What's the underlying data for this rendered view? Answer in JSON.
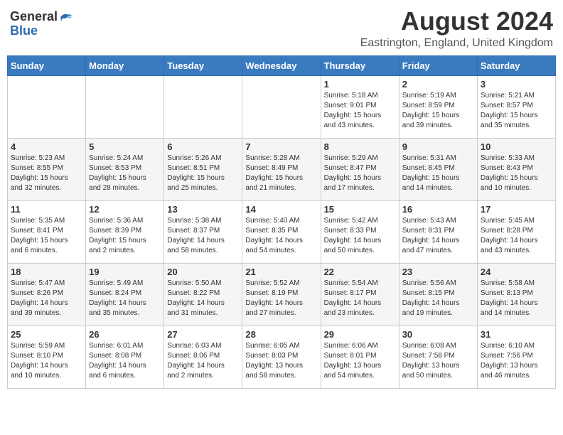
{
  "header": {
    "logo_general": "General",
    "logo_blue": "Blue",
    "month_year": "August 2024",
    "location": "Eastrington, England, United Kingdom"
  },
  "days_of_week": [
    "Sunday",
    "Monday",
    "Tuesday",
    "Wednesday",
    "Thursday",
    "Friday",
    "Saturday"
  ],
  "weeks": [
    [
      {
        "day": "",
        "info": ""
      },
      {
        "day": "",
        "info": ""
      },
      {
        "day": "",
        "info": ""
      },
      {
        "day": "",
        "info": ""
      },
      {
        "day": "1",
        "info": "Sunrise: 5:18 AM\nSunset: 9:01 PM\nDaylight: 15 hours\nand 43 minutes."
      },
      {
        "day": "2",
        "info": "Sunrise: 5:19 AM\nSunset: 8:59 PM\nDaylight: 15 hours\nand 39 minutes."
      },
      {
        "day": "3",
        "info": "Sunrise: 5:21 AM\nSunset: 8:57 PM\nDaylight: 15 hours\nand 35 minutes."
      }
    ],
    [
      {
        "day": "4",
        "info": "Sunrise: 5:23 AM\nSunset: 8:55 PM\nDaylight: 15 hours\nand 32 minutes."
      },
      {
        "day": "5",
        "info": "Sunrise: 5:24 AM\nSunset: 8:53 PM\nDaylight: 15 hours\nand 28 minutes."
      },
      {
        "day": "6",
        "info": "Sunrise: 5:26 AM\nSunset: 8:51 PM\nDaylight: 15 hours\nand 25 minutes."
      },
      {
        "day": "7",
        "info": "Sunrise: 5:28 AM\nSunset: 8:49 PM\nDaylight: 15 hours\nand 21 minutes."
      },
      {
        "day": "8",
        "info": "Sunrise: 5:29 AM\nSunset: 8:47 PM\nDaylight: 15 hours\nand 17 minutes."
      },
      {
        "day": "9",
        "info": "Sunrise: 5:31 AM\nSunset: 8:45 PM\nDaylight: 15 hours\nand 14 minutes."
      },
      {
        "day": "10",
        "info": "Sunrise: 5:33 AM\nSunset: 8:43 PM\nDaylight: 15 hours\nand 10 minutes."
      }
    ],
    [
      {
        "day": "11",
        "info": "Sunrise: 5:35 AM\nSunset: 8:41 PM\nDaylight: 15 hours\nand 6 minutes."
      },
      {
        "day": "12",
        "info": "Sunrise: 5:36 AM\nSunset: 8:39 PM\nDaylight: 15 hours\nand 2 minutes."
      },
      {
        "day": "13",
        "info": "Sunrise: 5:38 AM\nSunset: 8:37 PM\nDaylight: 14 hours\nand 58 minutes."
      },
      {
        "day": "14",
        "info": "Sunrise: 5:40 AM\nSunset: 8:35 PM\nDaylight: 14 hours\nand 54 minutes."
      },
      {
        "day": "15",
        "info": "Sunrise: 5:42 AM\nSunset: 8:33 PM\nDaylight: 14 hours\nand 50 minutes."
      },
      {
        "day": "16",
        "info": "Sunrise: 5:43 AM\nSunset: 8:31 PM\nDaylight: 14 hours\nand 47 minutes."
      },
      {
        "day": "17",
        "info": "Sunrise: 5:45 AM\nSunset: 8:28 PM\nDaylight: 14 hours\nand 43 minutes."
      }
    ],
    [
      {
        "day": "18",
        "info": "Sunrise: 5:47 AM\nSunset: 8:26 PM\nDaylight: 14 hours\nand 39 minutes."
      },
      {
        "day": "19",
        "info": "Sunrise: 5:49 AM\nSunset: 8:24 PM\nDaylight: 14 hours\nand 35 minutes."
      },
      {
        "day": "20",
        "info": "Sunrise: 5:50 AM\nSunset: 8:22 PM\nDaylight: 14 hours\nand 31 minutes."
      },
      {
        "day": "21",
        "info": "Sunrise: 5:52 AM\nSunset: 8:19 PM\nDaylight: 14 hours\nand 27 minutes."
      },
      {
        "day": "22",
        "info": "Sunrise: 5:54 AM\nSunset: 8:17 PM\nDaylight: 14 hours\nand 23 minutes."
      },
      {
        "day": "23",
        "info": "Sunrise: 5:56 AM\nSunset: 8:15 PM\nDaylight: 14 hours\nand 19 minutes."
      },
      {
        "day": "24",
        "info": "Sunrise: 5:58 AM\nSunset: 8:13 PM\nDaylight: 14 hours\nand 14 minutes."
      }
    ],
    [
      {
        "day": "25",
        "info": "Sunrise: 5:59 AM\nSunset: 8:10 PM\nDaylight: 14 hours\nand 10 minutes."
      },
      {
        "day": "26",
        "info": "Sunrise: 6:01 AM\nSunset: 8:08 PM\nDaylight: 14 hours\nand 6 minutes."
      },
      {
        "day": "27",
        "info": "Sunrise: 6:03 AM\nSunset: 8:06 PM\nDaylight: 14 hours\nand 2 minutes."
      },
      {
        "day": "28",
        "info": "Sunrise: 6:05 AM\nSunset: 8:03 PM\nDaylight: 13 hours\nand 58 minutes."
      },
      {
        "day": "29",
        "info": "Sunrise: 6:06 AM\nSunset: 8:01 PM\nDaylight: 13 hours\nand 54 minutes."
      },
      {
        "day": "30",
        "info": "Sunrise: 6:08 AM\nSunset: 7:58 PM\nDaylight: 13 hours\nand 50 minutes."
      },
      {
        "day": "31",
        "info": "Sunrise: 6:10 AM\nSunset: 7:56 PM\nDaylight: 13 hours\nand 46 minutes."
      }
    ]
  ]
}
